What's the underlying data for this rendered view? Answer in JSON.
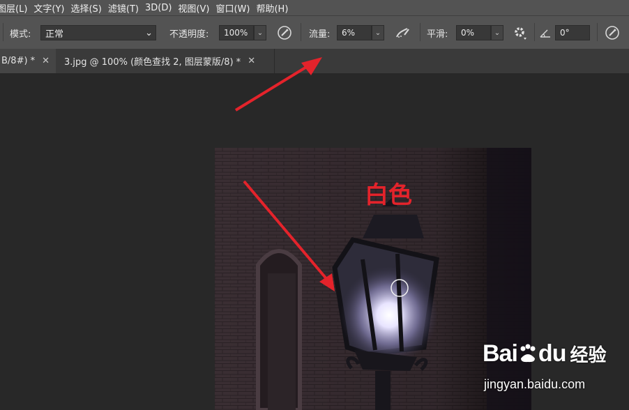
{
  "menu": [
    "图层(L)",
    "文字(Y)",
    "选择(S)",
    "滤镜(T)",
    "3D(D)",
    "视图(V)",
    "窗口(W)",
    "帮助(H)"
  ],
  "options": {
    "mode_label": "模式:",
    "mode_value": "正常",
    "opacity_label": "不透明度:",
    "opacity_value": "100%",
    "flow_label": "流量:",
    "flow_value": "6%",
    "smoothing_label": "平滑:",
    "smoothing_value": "0%",
    "angle_value": "0°"
  },
  "tabs": [
    {
      "label": "B/8#) *",
      "active": true
    },
    {
      "label": "3.jpg @ 100% (颜色查找 2, 图层蒙版/8) *",
      "active": false
    }
  ],
  "annotation": {
    "label": "白色",
    "color": "#e4232b"
  },
  "watermark": {
    "logo": "Bai",
    "logo_tail": "du",
    "logo_cn": "经验",
    "url": "jingyan.baidu.com"
  },
  "icons": {
    "airbrush_pressure": "pen-pressure-icon",
    "airbrush": "airbrush-icon",
    "settings": "gear-icon",
    "angle": "angle-icon",
    "pressure_size": "pressure-size-icon",
    "close": "close-icon",
    "dropdown": "chevron-down-icon"
  }
}
